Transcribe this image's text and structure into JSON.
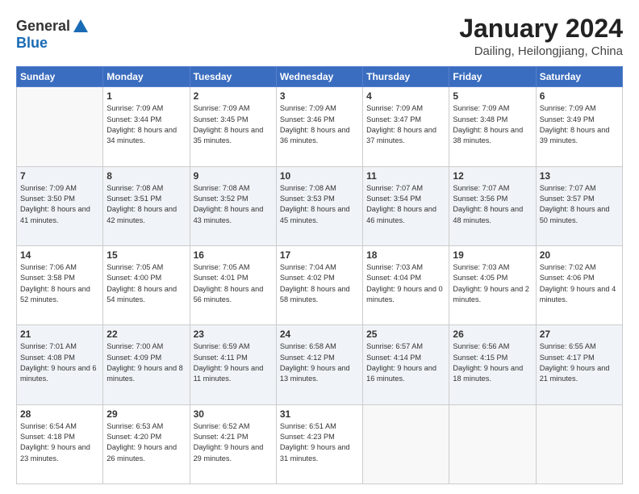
{
  "header": {
    "logo_general": "General",
    "logo_blue": "Blue",
    "month_title": "January 2024",
    "location": "Dailing, Heilongjiang, China"
  },
  "weekdays": [
    "Sunday",
    "Monday",
    "Tuesday",
    "Wednesday",
    "Thursday",
    "Friday",
    "Saturday"
  ],
  "weeks": [
    [
      {
        "day": "",
        "empty": true
      },
      {
        "day": "1",
        "sunrise": "7:09 AM",
        "sunset": "3:44 PM",
        "daylight": "8 hours and 34 minutes."
      },
      {
        "day": "2",
        "sunrise": "7:09 AM",
        "sunset": "3:45 PM",
        "daylight": "8 hours and 35 minutes."
      },
      {
        "day": "3",
        "sunrise": "7:09 AM",
        "sunset": "3:46 PM",
        "daylight": "8 hours and 36 minutes."
      },
      {
        "day": "4",
        "sunrise": "7:09 AM",
        "sunset": "3:47 PM",
        "daylight": "8 hours and 37 minutes."
      },
      {
        "day": "5",
        "sunrise": "7:09 AM",
        "sunset": "3:48 PM",
        "daylight": "8 hours and 38 minutes."
      },
      {
        "day": "6",
        "sunrise": "7:09 AM",
        "sunset": "3:49 PM",
        "daylight": "8 hours and 39 minutes."
      }
    ],
    [
      {
        "day": "7",
        "sunrise": "7:09 AM",
        "sunset": "3:50 PM",
        "daylight": "8 hours and 41 minutes."
      },
      {
        "day": "8",
        "sunrise": "7:08 AM",
        "sunset": "3:51 PM",
        "daylight": "8 hours and 42 minutes."
      },
      {
        "day": "9",
        "sunrise": "7:08 AM",
        "sunset": "3:52 PM",
        "daylight": "8 hours and 43 minutes."
      },
      {
        "day": "10",
        "sunrise": "7:08 AM",
        "sunset": "3:53 PM",
        "daylight": "8 hours and 45 minutes."
      },
      {
        "day": "11",
        "sunrise": "7:07 AM",
        "sunset": "3:54 PM",
        "daylight": "8 hours and 46 minutes."
      },
      {
        "day": "12",
        "sunrise": "7:07 AM",
        "sunset": "3:56 PM",
        "daylight": "8 hours and 48 minutes."
      },
      {
        "day": "13",
        "sunrise": "7:07 AM",
        "sunset": "3:57 PM",
        "daylight": "8 hours and 50 minutes."
      }
    ],
    [
      {
        "day": "14",
        "sunrise": "7:06 AM",
        "sunset": "3:58 PM",
        "daylight": "8 hours and 52 minutes."
      },
      {
        "day": "15",
        "sunrise": "7:05 AM",
        "sunset": "4:00 PM",
        "daylight": "8 hours and 54 minutes."
      },
      {
        "day": "16",
        "sunrise": "7:05 AM",
        "sunset": "4:01 PM",
        "daylight": "8 hours and 56 minutes."
      },
      {
        "day": "17",
        "sunrise": "7:04 AM",
        "sunset": "4:02 PM",
        "daylight": "8 hours and 58 minutes."
      },
      {
        "day": "18",
        "sunrise": "7:03 AM",
        "sunset": "4:04 PM",
        "daylight": "9 hours and 0 minutes."
      },
      {
        "day": "19",
        "sunrise": "7:03 AM",
        "sunset": "4:05 PM",
        "daylight": "9 hours and 2 minutes."
      },
      {
        "day": "20",
        "sunrise": "7:02 AM",
        "sunset": "4:06 PM",
        "daylight": "9 hours and 4 minutes."
      }
    ],
    [
      {
        "day": "21",
        "sunrise": "7:01 AM",
        "sunset": "4:08 PM",
        "daylight": "9 hours and 6 minutes."
      },
      {
        "day": "22",
        "sunrise": "7:00 AM",
        "sunset": "4:09 PM",
        "daylight": "9 hours and 8 minutes."
      },
      {
        "day": "23",
        "sunrise": "6:59 AM",
        "sunset": "4:11 PM",
        "daylight": "9 hours and 11 minutes."
      },
      {
        "day": "24",
        "sunrise": "6:58 AM",
        "sunset": "4:12 PM",
        "daylight": "9 hours and 13 minutes."
      },
      {
        "day": "25",
        "sunrise": "6:57 AM",
        "sunset": "4:14 PM",
        "daylight": "9 hours and 16 minutes."
      },
      {
        "day": "26",
        "sunrise": "6:56 AM",
        "sunset": "4:15 PM",
        "daylight": "9 hours and 18 minutes."
      },
      {
        "day": "27",
        "sunrise": "6:55 AM",
        "sunset": "4:17 PM",
        "daylight": "9 hours and 21 minutes."
      }
    ],
    [
      {
        "day": "28",
        "sunrise": "6:54 AM",
        "sunset": "4:18 PM",
        "daylight": "9 hours and 23 minutes."
      },
      {
        "day": "29",
        "sunrise": "6:53 AM",
        "sunset": "4:20 PM",
        "daylight": "9 hours and 26 minutes."
      },
      {
        "day": "30",
        "sunrise": "6:52 AM",
        "sunset": "4:21 PM",
        "daylight": "9 hours and 29 minutes."
      },
      {
        "day": "31",
        "sunrise": "6:51 AM",
        "sunset": "4:23 PM",
        "daylight": "9 hours and 31 minutes."
      },
      {
        "day": "",
        "empty": true
      },
      {
        "day": "",
        "empty": true
      },
      {
        "day": "",
        "empty": true
      }
    ]
  ]
}
